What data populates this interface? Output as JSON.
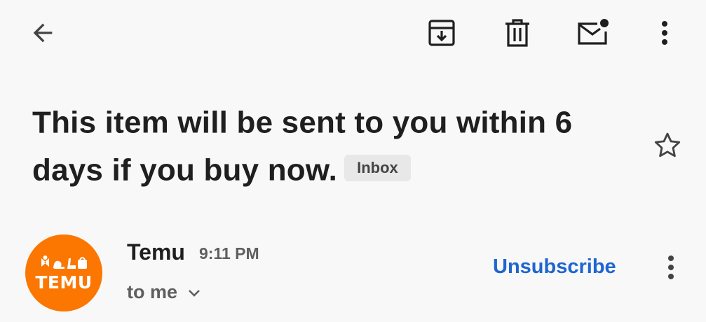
{
  "toolbar": {
    "back_icon": "arrow-back-icon",
    "archive_icon": "archive-icon",
    "delete_icon": "trash-icon",
    "unread_icon": "mark-unread-icon",
    "more_icon": "more-vert-icon"
  },
  "message": {
    "subject": "This item will be sent to you within 6 days if you buy now.",
    "label": "Inbox",
    "star_icon": "star-outline-icon"
  },
  "sender": {
    "avatar_text": "TEMU",
    "avatar_color": "#fb7701",
    "name": "Temu",
    "time": "9:11 PM",
    "recipient": "to me",
    "recipient_icon": "chevron-down-icon",
    "unsubscribe_label": "Unsubscribe",
    "unsubscribe_color": "#1f65d1",
    "more_icon": "more-vert-icon"
  }
}
